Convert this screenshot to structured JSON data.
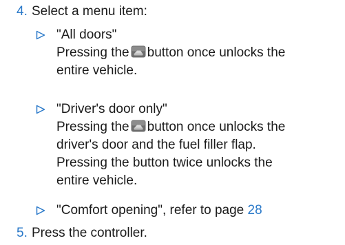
{
  "steps": [
    {
      "number": "4.",
      "text": "Select a menu item:"
    },
    {
      "number": "5.",
      "text": "Press the controller."
    }
  ],
  "options": [
    {
      "title": "\"All doors\"",
      "desc_before_icon": "Pressing the",
      "desc_after_icon": "button once unlocks the",
      "desc_lines": [
        "entire vehicle."
      ]
    },
    {
      "title": "\"Driver's door only\"",
      "desc_before_icon": "Pressing the",
      "desc_after_icon": "button once unlocks the",
      "desc_lines": [
        "driver's door and the fuel filler flap.",
        "Pressing the button twice unlocks the",
        "entire vehicle."
      ]
    },
    {
      "title_prefix": "\"Comfort opening\", refer to page",
      "page_ref": "28"
    }
  ],
  "colors": {
    "accent": "#2a79c9",
    "text": "#1a1a1a",
    "icon_bg": "#6d6d6d"
  },
  "icons": {
    "bullet": "triangle-outline-right-icon",
    "unlock_button": "unlock-button-icon"
  }
}
